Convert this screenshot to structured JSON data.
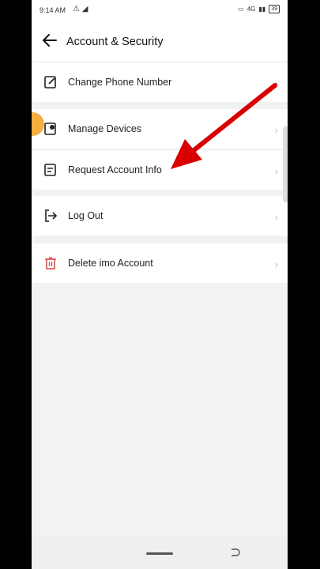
{
  "status": {
    "time": "9:14 AM",
    "battery": "39",
    "net": "4G"
  },
  "header": {
    "title": "Account & Security"
  },
  "items": [
    {
      "label": "Change Phone Number",
      "icon": "edit-phone-icon"
    },
    {
      "label": "Manage Devices",
      "icon": "device-gear-icon"
    },
    {
      "label": "Request Account Info",
      "icon": "document-icon"
    },
    {
      "label": "Log Out",
      "icon": "logout-icon"
    },
    {
      "label": "Delete imo Account",
      "icon": "trash-icon"
    }
  ],
  "colors": {
    "danger": "#d9534f",
    "annotation_arrow": "#d80000",
    "touch_indicator": "#f5a021"
  }
}
